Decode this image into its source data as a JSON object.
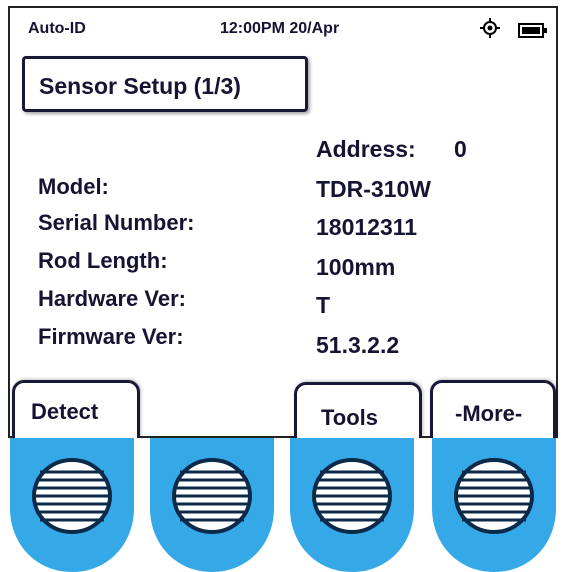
{
  "status_bar": {
    "mode": "Auto-ID",
    "datetime": "12:00PM 20/Apr",
    "gps_icon": "target-icon",
    "battery_icon": "battery-icon"
  },
  "title": "Sensor Setup (1/3)",
  "address": {
    "label": "Address:",
    "value": "0"
  },
  "fields": [
    {
      "label": "Model:",
      "value": "TDR-310W"
    },
    {
      "label": "Serial Number:",
      "value": "18012311"
    },
    {
      "label": "Rod Length:",
      "value": "100mm"
    },
    {
      "label": "Hardware Ver:",
      "value": "T"
    },
    {
      "label": "Firmware Ver:",
      "value": "51.3.2.2"
    }
  ],
  "softkeys": {
    "detect": "Detect",
    "tools": "Tools",
    "more": "-More-"
  },
  "colors": {
    "button_blue": "#35a8e8",
    "text": "#151533"
  }
}
